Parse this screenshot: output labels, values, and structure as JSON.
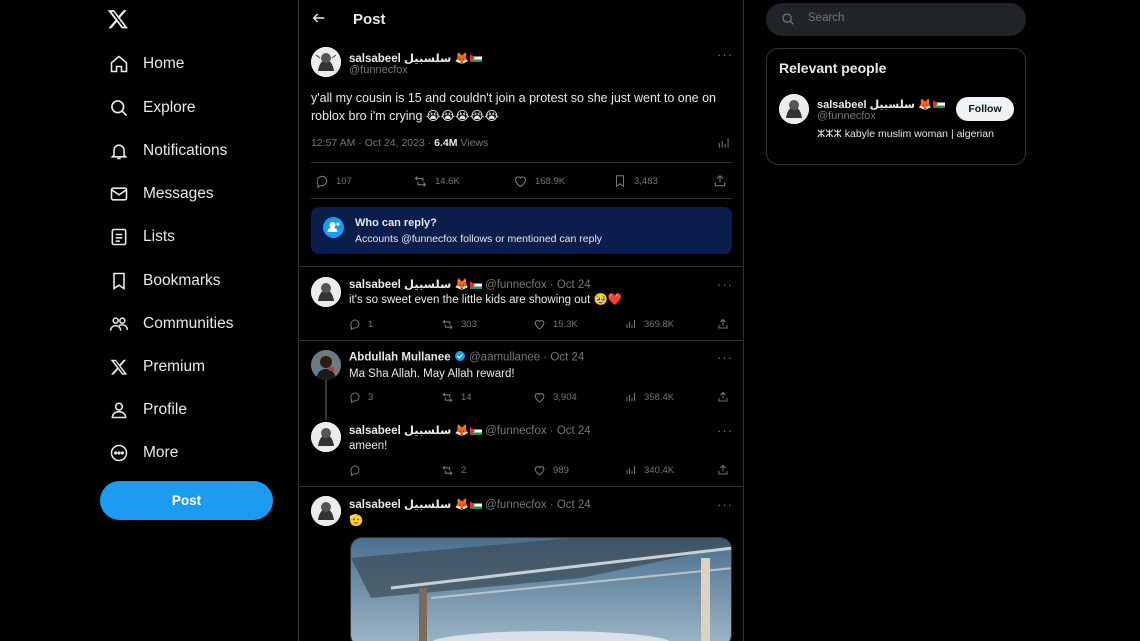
{
  "nav": {
    "items": [
      {
        "label": "Home",
        "icon": "home-icon"
      },
      {
        "label": "Explore",
        "icon": "search-icon"
      },
      {
        "label": "Notifications",
        "icon": "bell-icon"
      },
      {
        "label": "Messages",
        "icon": "envelope-icon"
      },
      {
        "label": "Lists",
        "icon": "list-icon"
      },
      {
        "label": "Bookmarks",
        "icon": "bookmark-icon"
      },
      {
        "label": "Communities",
        "icon": "communities-icon"
      },
      {
        "label": "Premium",
        "icon": "x-logo-icon"
      },
      {
        "label": "Profile",
        "icon": "person-icon"
      },
      {
        "label": "More",
        "icon": "more-circle-icon"
      }
    ],
    "post_button": "Post"
  },
  "header": {
    "title": "Post"
  },
  "main_post": {
    "name": "salsabeel سلسبيل 🦊",
    "handle": "@funnecfox",
    "text": "y'all my cousin is 15 and couldn't join a protest so she just went to one on roblox bro i'm crying 😭😭😭😭😭",
    "time": "12:57 AM · Oct 24, 2023 · ",
    "views_count": "6.4M",
    "views_label": " Views",
    "replies": "107",
    "reposts": "14.6K",
    "likes": "168.9K",
    "bookmarks": "3,483"
  },
  "reply_box": {
    "title": "Who can reply?",
    "subtitle": "Accounts @funnecfox follows or mentioned can reply"
  },
  "replies": [
    {
      "name": "salsabeel سلسبيل 🦊",
      "meta": "@funnecfox · Oct 24",
      "text": "it's so sweet even the little kids are showing out 🥹❤️",
      "replies": "1",
      "reposts": "303",
      "likes": "15.3K",
      "views": "369.8K"
    },
    {
      "name": "Abdullah Mullanee",
      "meta": "@aamullanee · Oct 24",
      "text": "Ma Sha Allah. May Allah reward!",
      "replies": "3",
      "reposts": "14",
      "likes": "3,904",
      "views": "358.4K"
    },
    {
      "name": "salsabeel سلسبيل 🦊",
      "meta": "@funnecfox · Oct 24",
      "text": "ameen!",
      "replies": "",
      "reposts": "2",
      "likes": "989",
      "views": "340.4K"
    },
    {
      "name": "salsabeel سلسبيل 🦊",
      "meta": "@funnecfox · Oct 24",
      "text": "🫡"
    }
  ],
  "search": {
    "placeholder": "Search"
  },
  "relevant": {
    "title": "Relevant people",
    "name": "salsabeel سلسبيل 🦊",
    "handle": "@funnecfox",
    "follow": "Follow",
    "bio": "ⵣⵣⵣ kabyle muslim woman | algerian"
  },
  "colors": {
    "accent": "#1d9bf0",
    "background": "#000000",
    "border": "#2f3336",
    "muted": "#71767b",
    "reply_box": "#0a1d4d"
  }
}
